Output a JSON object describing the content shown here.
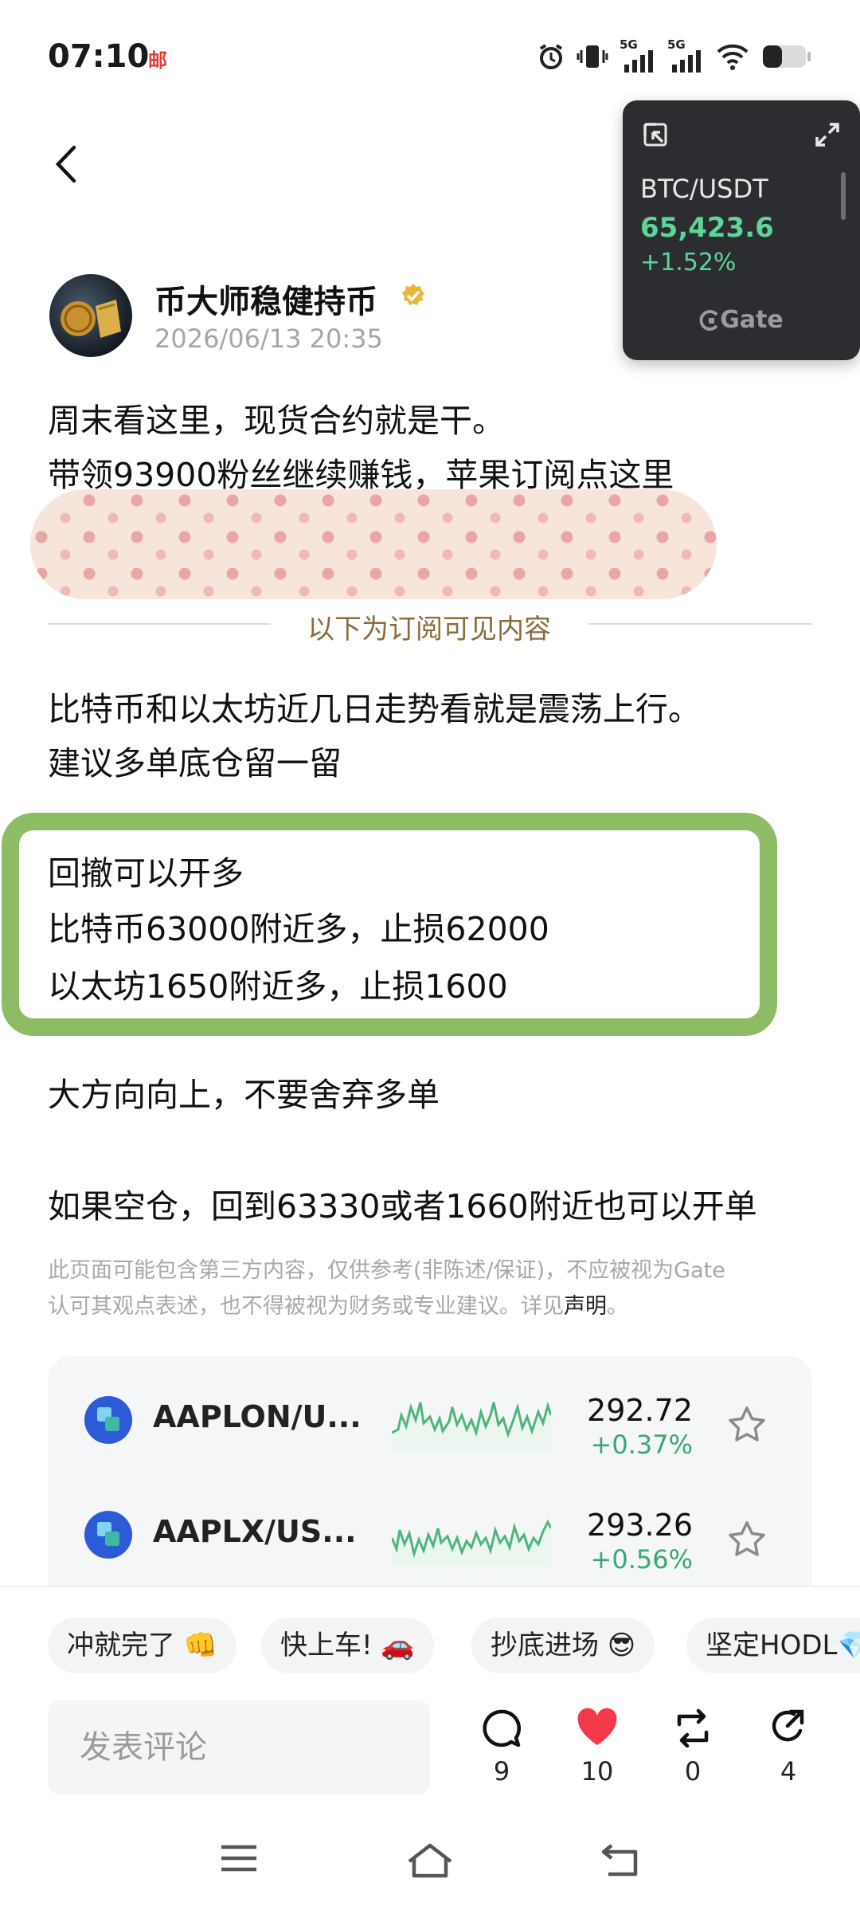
{
  "status_bar": {
    "time": "07:10",
    "app_badge": "邮",
    "signal_1_label": "5G",
    "signal_2_label": "5G"
  },
  "ticker": {
    "pair": "BTC/USDT",
    "price": "65,423.6",
    "change": "+1.52%",
    "brand": "Gate",
    "up_color": "#5dd598"
  },
  "author": {
    "name": "币大师稳健持币",
    "date": "2026/06/13 20:35"
  },
  "post": {
    "intro_lines": [
      "周末看这里，现货合约就是干。",
      "带领93900粉丝继续赚钱，苹果订阅点这里"
    ],
    "subscriber_label": "以下为订阅可见内容",
    "body_lines": [
      "比特币和以太坊近几日走势看就是震荡上行。",
      "建议多单底仓留一留"
    ],
    "highlight_lines": [
      "回撤可以开多",
      "比特币63000附近多，止损62000",
      "以太坊1650附近多，止损1600"
    ],
    "after_lines": [
      "大方向向上，不要舍弃多单",
      "如果空仓，回到63330或者1660附近也可以开单"
    ]
  },
  "disclaimer": {
    "text_line1": "此页面可能包含第三方内容，仅供参考(非陈述/保证)，不应被视为Gate",
    "text_line2": "认可其观点表述，也不得被视为财务或专业建议。详见",
    "link": "声明",
    "tail": "。"
  },
  "markets": [
    {
      "symbol": "AAPLON/U...",
      "price": "292.72",
      "change": "+0.37%"
    },
    {
      "symbol": "AAPLX/US...",
      "price": "293.26",
      "change": "+0.56%"
    }
  ],
  "quick_replies": [
    "冲就完了 👊",
    "快上车! 🚗",
    "抄底进场 😎",
    "坚定HODL💎"
  ],
  "comment_box": {
    "placeholder": "发表评论"
  },
  "actions": {
    "comments": "9",
    "likes": "10",
    "reposts": "0",
    "shares": "4"
  },
  "colors": {
    "accent_green": "#8ebc64",
    "up_green": "#3aa870",
    "like_red": "#f5384a"
  }
}
